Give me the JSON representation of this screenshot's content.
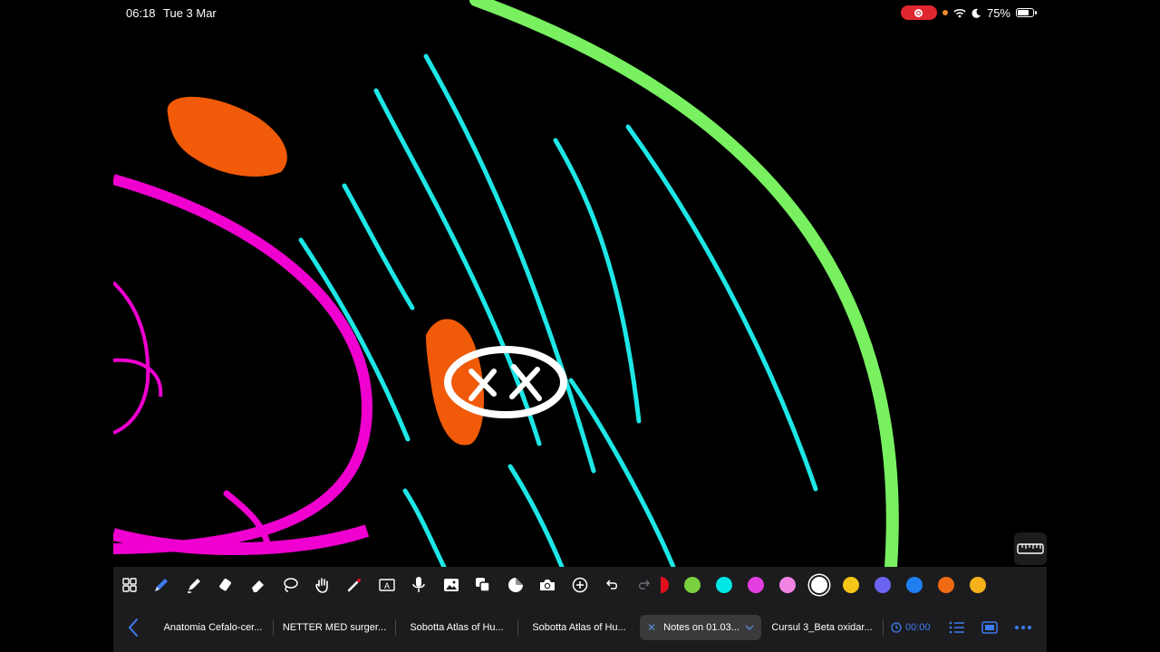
{
  "status_bar": {
    "time": "06:18",
    "date": "Tue 3 Mar",
    "battery": "75%",
    "battery_level": 0.75
  },
  "toolbar": {
    "tools": [
      {
        "name": "grid-icon"
      },
      {
        "name": "pen-icon",
        "selected": true
      },
      {
        "name": "highlighter-icon"
      },
      {
        "name": "tape-eraser-icon"
      },
      {
        "name": "eraser-icon"
      },
      {
        "name": "lasso-icon"
      },
      {
        "name": "hand-icon"
      },
      {
        "name": "laser-pointer-icon"
      },
      {
        "name": "text-box-icon"
      },
      {
        "name": "microphone-icon"
      },
      {
        "name": "image-icon"
      },
      {
        "name": "shapes-icon"
      },
      {
        "name": "sticker-icon"
      },
      {
        "name": "camera-icon"
      },
      {
        "name": "add-icon"
      },
      {
        "name": "undo-icon"
      },
      {
        "name": "redo-icon"
      }
    ],
    "colors": [
      "#7ad13f",
      "#00e5e5",
      "#e23ee0",
      "#f082e4",
      "#ffffff",
      "#f5c518",
      "#6b63f0",
      "#1f7ef0",
      "#f06a14",
      "#f5b21a"
    ],
    "partial_color": "#e0101e",
    "selected_color": "#ffffff"
  },
  "tabs": [
    {
      "label": "Anatomia Cefalo-cer..."
    },
    {
      "label": "NETTER MED surger..."
    },
    {
      "label": "Sobotta Atlas of Hu..."
    },
    {
      "label": "Sobotta Atlas of Hu..."
    },
    {
      "label": "Notes on 01.03...",
      "active": true
    },
    {
      "label": "Cursul 3_Beta oxidar..."
    }
  ],
  "timer": "00:00",
  "canvas_colors": {
    "cyan": "#1ee6e6",
    "green": "#78f060",
    "magenta": "#f000d0",
    "orange": "#f05a08",
    "white": "#ffffff"
  }
}
